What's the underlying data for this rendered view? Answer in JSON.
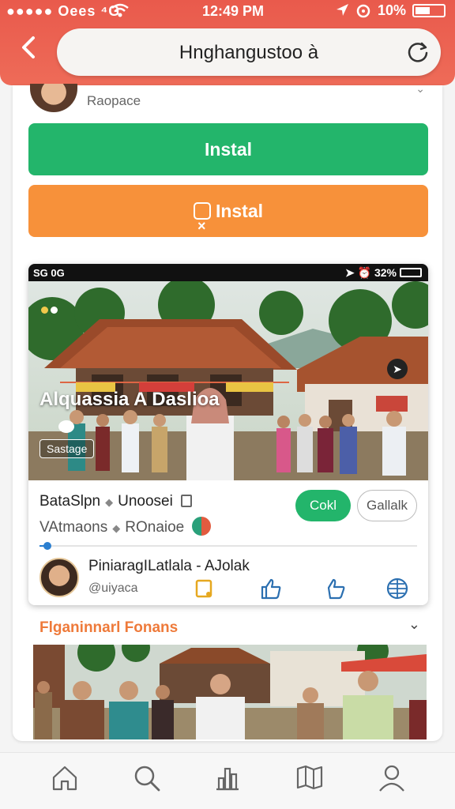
{
  "status_bar": {
    "signal": "●●●●● Oees ⁴G",
    "time": "12:49 PM",
    "battery": "10%"
  },
  "browser": {
    "url": "Hnghangustoo à"
  },
  "card": {
    "profile_label": "Raopace",
    "install_primary": "Instal",
    "install_secondary": "Instal"
  },
  "embed": {
    "status_left": "SG 0G",
    "status_right": "32%",
    "title": "Alquassia A Daslioa",
    "tag": "Sastage",
    "meta_line1": [
      "BataSlpn",
      "Unoosei"
    ],
    "meta_line2": [
      "VAtmaons",
      "ROnaioe"
    ],
    "btn_primary": "Cokl",
    "btn_secondary": "Gallalk",
    "progress": 0.02,
    "post_title": "PiniaragILatlala - AJolak",
    "post_handle": "@uiyaca"
  },
  "section": {
    "heading": "Flganinnarl Fonans"
  },
  "bottom_nav": [
    "home-icon",
    "search-icon",
    "chart-icon",
    "bookmark-map-icon",
    "profile-icon"
  ],
  "colors": {
    "header": "#e95a4c",
    "green": "#23b56b",
    "orange": "#f7913a",
    "section_heading": "#ee7a3a"
  }
}
